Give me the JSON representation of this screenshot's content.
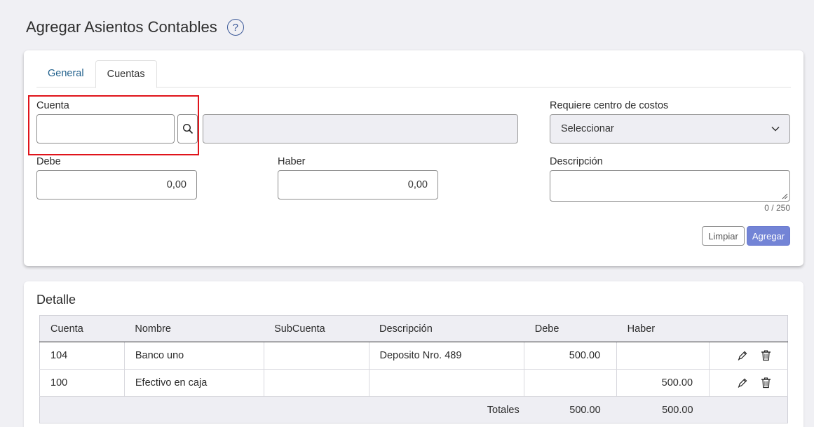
{
  "page": {
    "title": "Agregar Asientos Contables",
    "help_icon": "question-circle-icon"
  },
  "tabs": [
    {
      "label": "General"
    },
    {
      "label": "Cuentas"
    }
  ],
  "form": {
    "cuenta_label": "Cuenta",
    "cuenta_value": "",
    "cuenta_nombre": "",
    "requiere_label": "Requiere centro de costos",
    "requiere_value": "Seleccionar",
    "debe_label": "Debe",
    "debe_value": "0,00",
    "haber_label": "Haber",
    "haber_value": "0,00",
    "descripcion_label": "Descripción",
    "descripcion_value": "",
    "descripcion_counter": "0 / 250",
    "clear_label": "Limpiar",
    "add_label": "Agregar"
  },
  "colors": {
    "accent": "#7384d6",
    "tab_link": "#1f5f8b",
    "highlight": "#e0141b"
  },
  "detail": {
    "title": "Detalle",
    "columns": [
      "Cuenta",
      "Nombre",
      "SubCuenta",
      "Descripción",
      "Debe",
      "Haber"
    ],
    "rows": [
      {
        "cuenta": "104",
        "nombre": "Banco uno",
        "subcuenta": "",
        "descripcion": "Deposito Nro. 489",
        "debe": "500.00",
        "haber": ""
      },
      {
        "cuenta": "100",
        "nombre": "Efectivo en caja",
        "subcuenta": "",
        "descripcion": "",
        "debe": "",
        "haber": "500.00"
      }
    ],
    "totals": {
      "label": "Totales",
      "debe": "500.00",
      "haber": "500.00"
    }
  }
}
